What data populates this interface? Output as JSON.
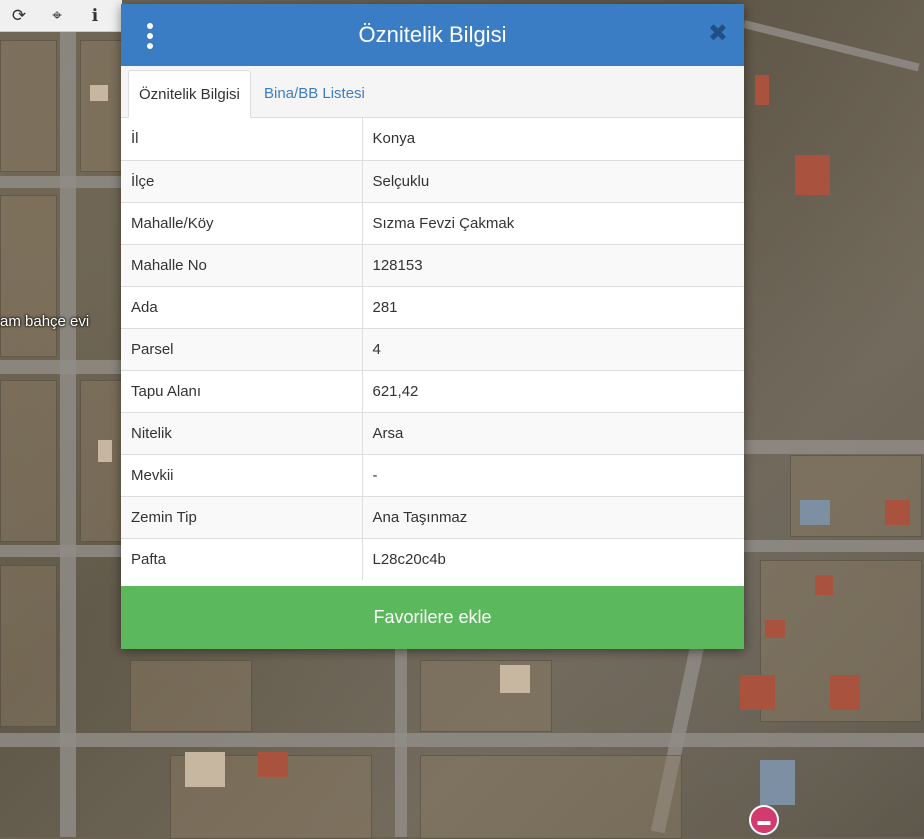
{
  "toolbar": {
    "tools": [
      {
        "icon": "refresh-icon",
        "glyph": "⟳"
      },
      {
        "icon": "crosshair-icon",
        "glyph": "⌖"
      },
      {
        "icon": "info-icon",
        "glyph": "ℹ"
      }
    ]
  },
  "map": {
    "label": "am bahçe evi",
    "pin_icon": "bed-icon"
  },
  "dialog": {
    "title": "Öznitelik Bilgisi",
    "close_glyph": "✖",
    "tabs": [
      {
        "label": "Öznitelik Bilgisi",
        "active": true
      },
      {
        "label": "Bina/BB Listesi",
        "active": false
      }
    ],
    "attributes": [
      {
        "key": "İl",
        "value": "Konya"
      },
      {
        "key": "İlçe",
        "value": "Selçuklu"
      },
      {
        "key": "Mahalle/Köy",
        "value": "Sızma Fevzi Çakmak"
      },
      {
        "key": "Mahalle No",
        "value": "128153"
      },
      {
        "key": "Ada",
        "value": "281"
      },
      {
        "key": "Parsel",
        "value": "4"
      },
      {
        "key": "Tapu Alanı",
        "value": "621,42"
      },
      {
        "key": "Nitelik",
        "value": "Arsa"
      },
      {
        "key": "Mevkii",
        "value": "-"
      },
      {
        "key": "Zemin Tip",
        "value": "Ana Taşınmaz"
      },
      {
        "key": "Pafta",
        "value": "L28c20c4b"
      }
    ],
    "favorite_button": "Favorilere ekle"
  },
  "colors": {
    "header": "#3b7dc4",
    "favorite": "#5cb85c",
    "tab_link": "#3b7dc4"
  }
}
